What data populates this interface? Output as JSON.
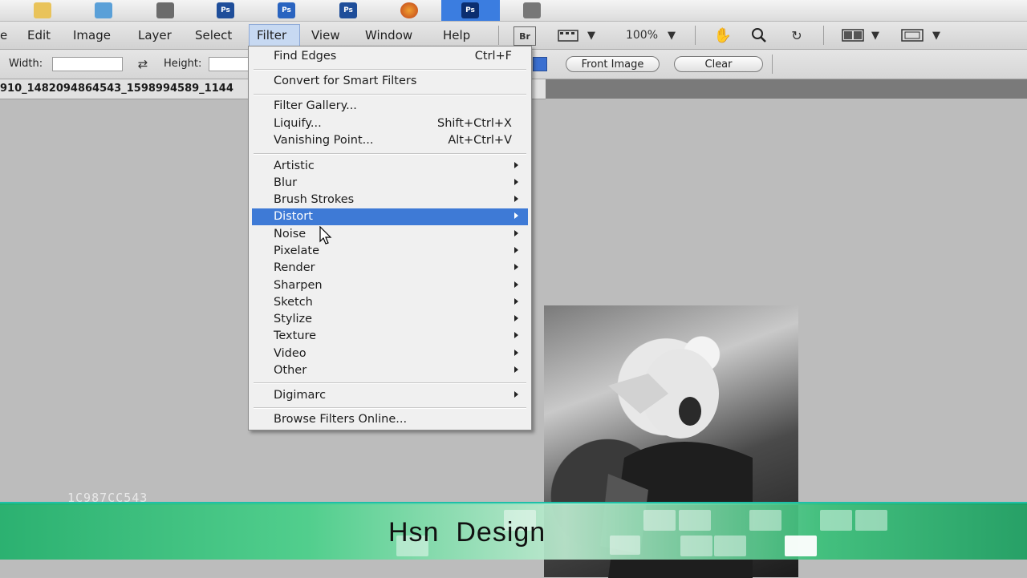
{
  "menubar": {
    "items": [
      "e",
      "Edit",
      "Image",
      "Layer",
      "Select",
      "Filter",
      "View",
      "Window",
      "Help"
    ],
    "bridge_label": "Br",
    "zoom_value": "100%"
  },
  "options": {
    "width_label": "Width:",
    "height_label": "Height:",
    "front_image_label": "Front Image",
    "clear_label": "Clear"
  },
  "document": {
    "tab_title": "910_1482094864543_1598994589_1144"
  },
  "filter_menu": {
    "find_edges": {
      "label": "Find Edges",
      "shortcut": "Ctrl+F"
    },
    "convert": {
      "label": "Convert for Smart Filters"
    },
    "filter_gallery": {
      "label": "Filter Gallery..."
    },
    "liquify": {
      "label": "Liquify...",
      "shortcut": "Shift+Ctrl+X"
    },
    "vanishing_point": {
      "label": "Vanishing Point...",
      "shortcut": "Alt+Ctrl+V"
    },
    "submenus": [
      "Artistic",
      "Blur",
      "Brush Strokes",
      "Distort",
      "Noise",
      "Pixelate",
      "Render",
      "Sharpen",
      "Sketch",
      "Stylize",
      "Texture",
      "Video",
      "Other"
    ],
    "highlighted": "Distort",
    "digimarc": {
      "label": "Digimarc"
    },
    "browse": {
      "label": "Browse Filters Online..."
    }
  },
  "watermark": {
    "brand": "Hsn  Design",
    "code": "1C987CC543"
  },
  "colors": {
    "menu_highlight": "#3e7ad6",
    "band_green": "#48d089"
  }
}
